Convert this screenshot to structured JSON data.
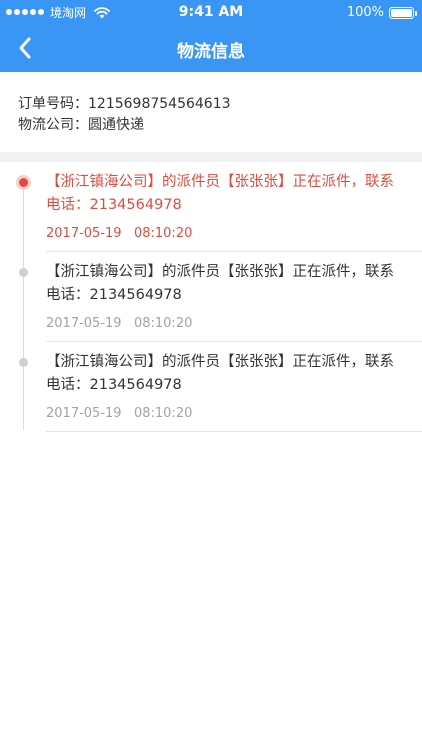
{
  "status_bar": {
    "carrier": "境淘网",
    "time": "9:41 AM",
    "battery": "100%"
  },
  "header": {
    "title": "物流信息",
    "back_icon": "chevron-left-icon"
  },
  "order": {
    "number_label": "订单号码：",
    "number": "1215698754564613",
    "company_label": "物流公司：",
    "company": "圆通快递"
  },
  "timeline": [
    {
      "text": "【浙江镇海公司】的派件员【张张张】正在派件，联系电话：2134564978",
      "date": "2017-05-19",
      "time": "08:10:20",
      "active": true
    },
    {
      "text": "【浙江镇海公司】的派件员【张张张】正在派件，联系电话：2134564978",
      "date": "2017-05-19",
      "time": "08:10:20",
      "active": false
    },
    {
      "text": "【浙江镇海公司】的派件员【张张张】正在派件，联系电话：2134564978",
      "date": "2017-05-19",
      "time": "08:10:20",
      "active": false
    }
  ],
  "colors": {
    "header_bg": "#3a96f5",
    "active": "#e04b3f",
    "text": "#333333",
    "muted": "#a3a3a3"
  }
}
